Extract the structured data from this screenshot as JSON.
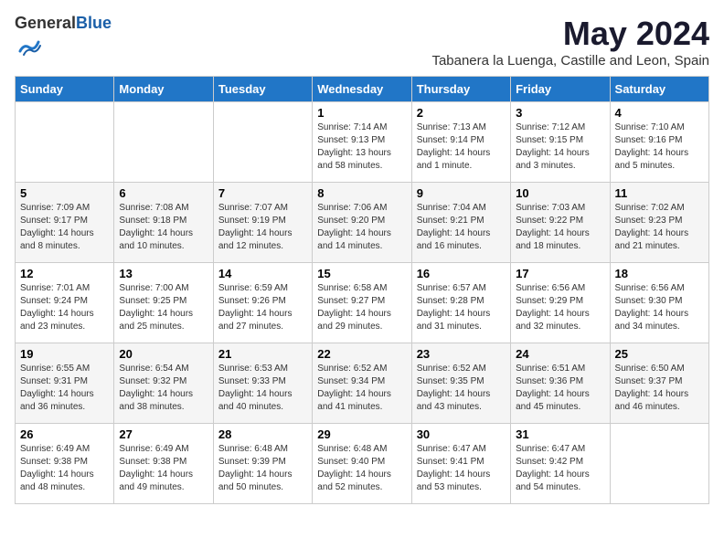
{
  "header": {
    "logo_general": "General",
    "logo_blue": "Blue",
    "month_title": "May 2024",
    "subtitle": "Tabanera la Luenga, Castille and Leon, Spain"
  },
  "weekdays": [
    "Sunday",
    "Monday",
    "Tuesday",
    "Wednesday",
    "Thursday",
    "Friday",
    "Saturday"
  ],
  "weeks": [
    [
      {
        "day": "",
        "sunrise": "",
        "sunset": "",
        "daylight": ""
      },
      {
        "day": "",
        "sunrise": "",
        "sunset": "",
        "daylight": ""
      },
      {
        "day": "",
        "sunrise": "",
        "sunset": "",
        "daylight": ""
      },
      {
        "day": "1",
        "sunrise": "Sunrise: 7:14 AM",
        "sunset": "Sunset: 9:13 PM",
        "daylight": "Daylight: 13 hours and 58 minutes."
      },
      {
        "day": "2",
        "sunrise": "Sunrise: 7:13 AM",
        "sunset": "Sunset: 9:14 PM",
        "daylight": "Daylight: 14 hours and 1 minute."
      },
      {
        "day": "3",
        "sunrise": "Sunrise: 7:12 AM",
        "sunset": "Sunset: 9:15 PM",
        "daylight": "Daylight: 14 hours and 3 minutes."
      },
      {
        "day": "4",
        "sunrise": "Sunrise: 7:10 AM",
        "sunset": "Sunset: 9:16 PM",
        "daylight": "Daylight: 14 hours and 5 minutes."
      }
    ],
    [
      {
        "day": "5",
        "sunrise": "Sunrise: 7:09 AM",
        "sunset": "Sunset: 9:17 PM",
        "daylight": "Daylight: 14 hours and 8 minutes."
      },
      {
        "day": "6",
        "sunrise": "Sunrise: 7:08 AM",
        "sunset": "Sunset: 9:18 PM",
        "daylight": "Daylight: 14 hours and 10 minutes."
      },
      {
        "day": "7",
        "sunrise": "Sunrise: 7:07 AM",
        "sunset": "Sunset: 9:19 PM",
        "daylight": "Daylight: 14 hours and 12 minutes."
      },
      {
        "day": "8",
        "sunrise": "Sunrise: 7:06 AM",
        "sunset": "Sunset: 9:20 PM",
        "daylight": "Daylight: 14 hours and 14 minutes."
      },
      {
        "day": "9",
        "sunrise": "Sunrise: 7:04 AM",
        "sunset": "Sunset: 9:21 PM",
        "daylight": "Daylight: 14 hours and 16 minutes."
      },
      {
        "day": "10",
        "sunrise": "Sunrise: 7:03 AM",
        "sunset": "Sunset: 9:22 PM",
        "daylight": "Daylight: 14 hours and 18 minutes."
      },
      {
        "day": "11",
        "sunrise": "Sunrise: 7:02 AM",
        "sunset": "Sunset: 9:23 PM",
        "daylight": "Daylight: 14 hours and 21 minutes."
      }
    ],
    [
      {
        "day": "12",
        "sunrise": "Sunrise: 7:01 AM",
        "sunset": "Sunset: 9:24 PM",
        "daylight": "Daylight: 14 hours and 23 minutes."
      },
      {
        "day": "13",
        "sunrise": "Sunrise: 7:00 AM",
        "sunset": "Sunset: 9:25 PM",
        "daylight": "Daylight: 14 hours and 25 minutes."
      },
      {
        "day": "14",
        "sunrise": "Sunrise: 6:59 AM",
        "sunset": "Sunset: 9:26 PM",
        "daylight": "Daylight: 14 hours and 27 minutes."
      },
      {
        "day": "15",
        "sunrise": "Sunrise: 6:58 AM",
        "sunset": "Sunset: 9:27 PM",
        "daylight": "Daylight: 14 hours and 29 minutes."
      },
      {
        "day": "16",
        "sunrise": "Sunrise: 6:57 AM",
        "sunset": "Sunset: 9:28 PM",
        "daylight": "Daylight: 14 hours and 31 minutes."
      },
      {
        "day": "17",
        "sunrise": "Sunrise: 6:56 AM",
        "sunset": "Sunset: 9:29 PM",
        "daylight": "Daylight: 14 hours and 32 minutes."
      },
      {
        "day": "18",
        "sunrise": "Sunrise: 6:56 AM",
        "sunset": "Sunset: 9:30 PM",
        "daylight": "Daylight: 14 hours and 34 minutes."
      }
    ],
    [
      {
        "day": "19",
        "sunrise": "Sunrise: 6:55 AM",
        "sunset": "Sunset: 9:31 PM",
        "daylight": "Daylight: 14 hours and 36 minutes."
      },
      {
        "day": "20",
        "sunrise": "Sunrise: 6:54 AM",
        "sunset": "Sunset: 9:32 PM",
        "daylight": "Daylight: 14 hours and 38 minutes."
      },
      {
        "day": "21",
        "sunrise": "Sunrise: 6:53 AM",
        "sunset": "Sunset: 9:33 PM",
        "daylight": "Daylight: 14 hours and 40 minutes."
      },
      {
        "day": "22",
        "sunrise": "Sunrise: 6:52 AM",
        "sunset": "Sunset: 9:34 PM",
        "daylight": "Daylight: 14 hours and 41 minutes."
      },
      {
        "day": "23",
        "sunrise": "Sunrise: 6:52 AM",
        "sunset": "Sunset: 9:35 PM",
        "daylight": "Daylight: 14 hours and 43 minutes."
      },
      {
        "day": "24",
        "sunrise": "Sunrise: 6:51 AM",
        "sunset": "Sunset: 9:36 PM",
        "daylight": "Daylight: 14 hours and 45 minutes."
      },
      {
        "day": "25",
        "sunrise": "Sunrise: 6:50 AM",
        "sunset": "Sunset: 9:37 PM",
        "daylight": "Daylight: 14 hours and 46 minutes."
      }
    ],
    [
      {
        "day": "26",
        "sunrise": "Sunrise: 6:49 AM",
        "sunset": "Sunset: 9:38 PM",
        "daylight": "Daylight: 14 hours and 48 minutes."
      },
      {
        "day": "27",
        "sunrise": "Sunrise: 6:49 AM",
        "sunset": "Sunset: 9:38 PM",
        "daylight": "Daylight: 14 hours and 49 minutes."
      },
      {
        "day": "28",
        "sunrise": "Sunrise: 6:48 AM",
        "sunset": "Sunset: 9:39 PM",
        "daylight": "Daylight: 14 hours and 50 minutes."
      },
      {
        "day": "29",
        "sunrise": "Sunrise: 6:48 AM",
        "sunset": "Sunset: 9:40 PM",
        "daylight": "Daylight: 14 hours and 52 minutes."
      },
      {
        "day": "30",
        "sunrise": "Sunrise: 6:47 AM",
        "sunset": "Sunset: 9:41 PM",
        "daylight": "Daylight: 14 hours and 53 minutes."
      },
      {
        "day": "31",
        "sunrise": "Sunrise: 6:47 AM",
        "sunset": "Sunset: 9:42 PM",
        "daylight": "Daylight: 14 hours and 54 minutes."
      },
      {
        "day": "",
        "sunrise": "",
        "sunset": "",
        "daylight": ""
      }
    ]
  ]
}
